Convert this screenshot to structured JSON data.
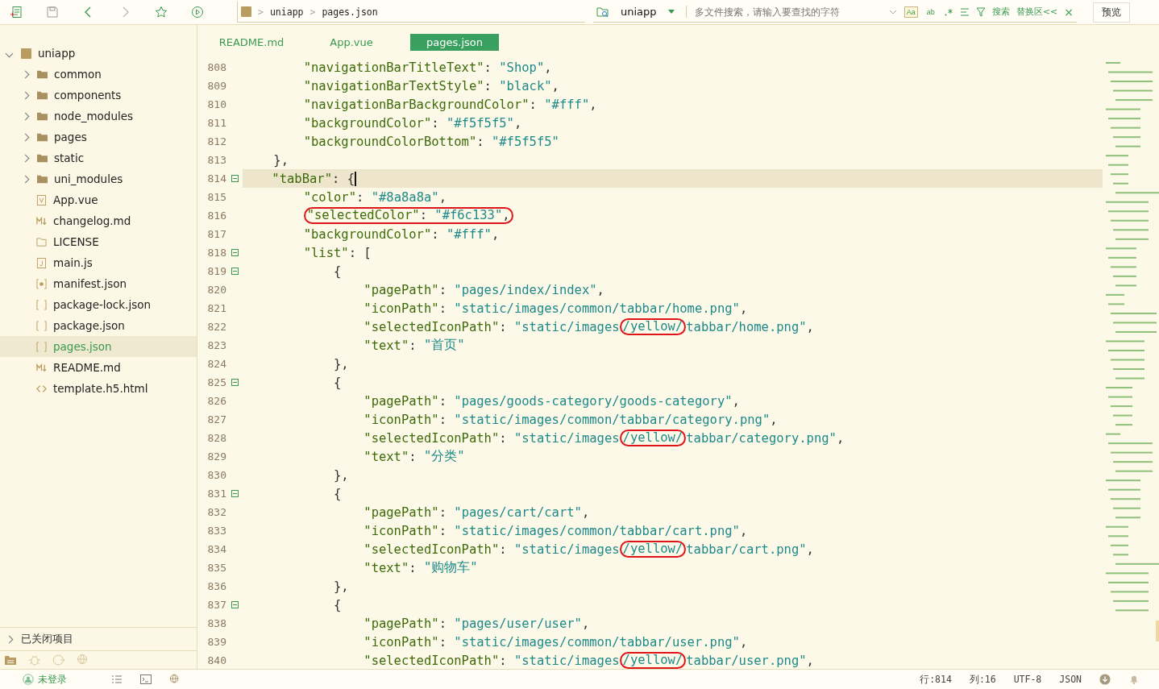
{
  "toolbar": {
    "breadcrumb": [
      "uniapp",
      "pages.json"
    ],
    "breadcrumb_sep": ">"
  },
  "search": {
    "scope": "uniapp",
    "placeholder": "多文件搜索，请输入要查找的字符",
    "options": [
      {
        "label": "Aa",
        "on": true
      },
      {
        "label": "ab",
        "on": false
      }
    ],
    "search_label": "搜索",
    "replace_label": "替换区<<",
    "close": "×",
    "preview": "预览"
  },
  "sidebar": {
    "root": {
      "label": "uniapp",
      "expanded": true,
      "children": [
        {
          "label": "common",
          "kind": "folder",
          "expanded": false,
          "selected": false
        },
        {
          "label": "components",
          "kind": "folder",
          "expanded": false,
          "selected": false
        },
        {
          "label": "node_modules",
          "kind": "folder",
          "expanded": false,
          "selected": false
        },
        {
          "label": "pages",
          "kind": "folder",
          "expanded": false,
          "selected": false
        },
        {
          "label": "static",
          "kind": "folder",
          "expanded": false,
          "selected": false
        },
        {
          "label": "uni_modules",
          "kind": "folder",
          "expanded": false,
          "selected": false
        },
        {
          "label": "App.vue",
          "kind": "vue",
          "selected": false
        },
        {
          "label": "changelog.md",
          "kind": "md",
          "selected": false
        },
        {
          "label": "LICENSE",
          "kind": "file",
          "selected": false
        },
        {
          "label": "main.js",
          "kind": "js",
          "selected": false
        },
        {
          "label": "manifest.json",
          "kind": "manifest",
          "selected": false
        },
        {
          "label": "package-lock.json",
          "kind": "json",
          "selected": false
        },
        {
          "label": "package.json",
          "kind": "json",
          "selected": false
        },
        {
          "label": "pages.json",
          "kind": "json",
          "selected": true
        },
        {
          "label": "README.md",
          "kind": "md",
          "selected": false
        },
        {
          "label": "template.h5.html",
          "kind": "html",
          "selected": false
        }
      ]
    },
    "closed_projects": "已关闭项目"
  },
  "tabs": [
    {
      "label": "README.md",
      "selected": false
    },
    {
      "label": "App.vue",
      "selected": false
    },
    {
      "label": "pages.json",
      "selected": true
    }
  ],
  "editor": {
    "lines": [
      {
        "children": [
          {
            "n": "808",
            "fold": false,
            "current": false,
            "parts": [
              {
                "kind": "k",
                "text": "\"navigationBarTitleText\""
              },
              {
                "kind": "p",
                "text": ": "
              },
              {
                "kind": "s",
                "text": "\"Shop\""
              },
              {
                "kind": "p",
                "text": ","
              }
            ]
          },
          {
            "n": "809",
            "fold": false,
            "current": false,
            "parts": [
              {
                "kind": "k",
                "text": "\"navigationBarTextStyle\""
              },
              {
                "kind": "p",
                "text": ": "
              },
              {
                "kind": "s",
                "text": "\"black\""
              },
              {
                "kind": "p",
                "text": ","
              }
            ]
          },
          {
            "n": "810",
            "fold": false,
            "current": false,
            "parts": [
              {
                "kind": "k",
                "text": "\"navigationBarBackgroundColor\""
              },
              {
                "kind": "p",
                "text": ": "
              },
              {
                "kind": "s",
                "text": "\"#fff\""
              },
              {
                "kind": "p",
                "text": ","
              }
            ]
          },
          {
            "n": "811",
            "fold": false,
            "current": false,
            "parts": [
              {
                "kind": "k",
                "text": "\"backgroundColor\""
              },
              {
                "kind": "p",
                "text": ": "
              },
              {
                "kind": "s",
                "text": "\"#f5f5f5\""
              },
              {
                "kind": "p",
                "text": ","
              }
            ]
          },
          {
            "n": "812",
            "fold": false,
            "current": false,
            "parts": [
              {
                "kind": "k",
                "text": "\"backgroundColorBottom\""
              },
              {
                "kind": "p",
                "text": ": "
              },
              {
                "kind": "s",
                "text": "\"#f5f5f5\""
              }
            ]
          }
        ]
      },
      {
        "n": "813",
        "fold": false,
        "current": false,
        "parts": [
          {
            "kind": "p",
            "text": "},"
          }
        ]
      },
      {
        "n": "814",
        "fold": true,
        "current": true,
        "parts": [
          {
            "kind": "k",
            "text": "\"tabBar\""
          },
          {
            "kind": "p",
            "text": ": {"
          }
        ],
        "children": [
          {
            "n": "815",
            "fold": false,
            "current": false,
            "parts": [
              {
                "kind": "k",
                "text": "\"color\""
              },
              {
                "kind": "p",
                "text": ": "
              },
              {
                "kind": "s",
                "text": "\"#8a8a8a\""
              },
              {
                "kind": "p",
                "text": ","
              }
            ]
          },
          {
            "n": "816",
            "fold": false,
            "current": false,
            "parts": [
              {
                "kind": "circle",
                "parts": [
                  {
                    "kind": "k",
                    "text": "\"selectedColor\""
                  },
                  {
                    "kind": "p",
                    "text": ": "
                  },
                  {
                    "kind": "s",
                    "text": "\"#f6c133\""
                  },
                  {
                    "kind": "p",
                    "text": ","
                  }
                ]
              }
            ]
          },
          {
            "n": "817",
            "fold": false,
            "current": false,
            "parts": [
              {
                "kind": "k",
                "text": "\"backgroundColor\""
              },
              {
                "kind": "p",
                "text": ": "
              },
              {
                "kind": "s",
                "text": "\"#fff\""
              },
              {
                "kind": "p",
                "text": ","
              }
            ]
          },
          {
            "n": "818",
            "fold": true,
            "current": false,
            "parts": [
              {
                "kind": "k",
                "text": "\"list\""
              },
              {
                "kind": "p",
                "text": ": ["
              }
            ],
            "children": [
              {
                "n": "819",
                "fold": true,
                "current": false,
                "parts": [
                  {
                    "kind": "p",
                    "text": "{"
                  }
                ],
                "children": [
                  {
                    "n": "820",
                    "fold": false,
                    "current": false,
                    "parts": [
                      {
                        "kind": "k",
                        "text": "\"pagePath\""
                      },
                      {
                        "kind": "p",
                        "text": ": "
                      },
                      {
                        "kind": "s",
                        "text": "\"pages/index/index\""
                      },
                      {
                        "kind": "p",
                        "text": ","
                      }
                    ]
                  },
                  {
                    "n": "821",
                    "fold": false,
                    "current": false,
                    "parts": [
                      {
                        "kind": "k",
                        "text": "\"iconPath\""
                      },
                      {
                        "kind": "p",
                        "text": ": "
                      },
                      {
                        "kind": "s",
                        "text": "\"static/images/common/tabbar/home.png\""
                      },
                      {
                        "kind": "p",
                        "text": ","
                      }
                    ]
                  },
                  {
                    "n": "822",
                    "fold": false,
                    "current": false,
                    "parts": [
                      {
                        "kind": "k",
                        "text": "\"selectedIconPath\""
                      },
                      {
                        "kind": "p",
                        "text": ": "
                      },
                      {
                        "kind": "s",
                        "text": "\"static/images"
                      },
                      {
                        "kind": "circle",
                        "parts": [
                          {
                            "kind": "s",
                            "text": "/yellow/"
                          }
                        ]
                      },
                      {
                        "kind": "s",
                        "text": "tabbar/home.png\""
                      },
                      {
                        "kind": "p",
                        "text": ","
                      }
                    ]
                  },
                  {
                    "n": "823",
                    "fold": false,
                    "current": false,
                    "parts": [
                      {
                        "kind": "k",
                        "text": "\"text\""
                      },
                      {
                        "kind": "p",
                        "text": ": "
                      },
                      {
                        "kind": "s",
                        "text": "\"首页\""
                      }
                    ]
                  }
                ]
              },
              {
                "n": "824",
                "fold": false,
                "current": false,
                "parts": [
                  {
                    "kind": "p",
                    "text": "},"
                  }
                ]
              },
              {
                "n": "825",
                "fold": true,
                "current": false,
                "parts": [
                  {
                    "kind": "p",
                    "text": "{"
                  }
                ],
                "children": [
                  {
                    "n": "826",
                    "fold": false,
                    "current": false,
                    "parts": [
                      {
                        "kind": "k",
                        "text": "\"pagePath\""
                      },
                      {
                        "kind": "p",
                        "text": ": "
                      },
                      {
                        "kind": "s",
                        "text": "\"pages/goods-category/goods-category\""
                      },
                      {
                        "kind": "p",
                        "text": ","
                      }
                    ]
                  },
                  {
                    "n": "827",
                    "fold": false,
                    "current": false,
                    "parts": [
                      {
                        "kind": "k",
                        "text": "\"iconPath\""
                      },
                      {
                        "kind": "p",
                        "text": ": "
                      },
                      {
                        "kind": "s",
                        "text": "\"static/images/common/tabbar/category.png\""
                      },
                      {
                        "kind": "p",
                        "text": ","
                      }
                    ]
                  },
                  {
                    "n": "828",
                    "fold": false,
                    "current": false,
                    "parts": [
                      {
                        "kind": "k",
                        "text": "\"selectedIconPath\""
                      },
                      {
                        "kind": "p",
                        "text": ": "
                      },
                      {
                        "kind": "s",
                        "text": "\"static/images"
                      },
                      {
                        "kind": "circle",
                        "parts": [
                          {
                            "kind": "s",
                            "text": "/yellow/"
                          }
                        ]
                      },
                      {
                        "kind": "s",
                        "text": "tabbar/category.png\""
                      },
                      {
                        "kind": "p",
                        "text": ","
                      }
                    ]
                  },
                  {
                    "n": "829",
                    "fold": false,
                    "current": false,
                    "parts": [
                      {
                        "kind": "k",
                        "text": "\"text\""
                      },
                      {
                        "kind": "p",
                        "text": ": "
                      },
                      {
                        "kind": "s",
                        "text": "\"分类\""
                      }
                    ]
                  }
                ]
              },
              {
                "n": "830",
                "fold": false,
                "current": false,
                "parts": [
                  {
                    "kind": "p",
                    "text": "},"
                  }
                ]
              },
              {
                "n": "831",
                "fold": true,
                "current": false,
                "parts": [
                  {
                    "kind": "p",
                    "text": "{"
                  }
                ],
                "children": [
                  {
                    "n": "832",
                    "fold": false,
                    "current": false,
                    "parts": [
                      {
                        "kind": "k",
                        "text": "\"pagePath\""
                      },
                      {
                        "kind": "p",
                        "text": ": "
                      },
                      {
                        "kind": "s",
                        "text": "\"pages/cart/cart\""
                      },
                      {
                        "kind": "p",
                        "text": ","
                      }
                    ]
                  },
                  {
                    "n": "833",
                    "fold": false,
                    "current": false,
                    "parts": [
                      {
                        "kind": "k",
                        "text": "\"iconPath\""
                      },
                      {
                        "kind": "p",
                        "text": ": "
                      },
                      {
                        "kind": "s",
                        "text": "\"static/images/common/tabbar/cart.png\""
                      },
                      {
                        "kind": "p",
                        "text": ","
                      }
                    ]
                  },
                  {
                    "n": "834",
                    "fold": false,
                    "current": false,
                    "parts": [
                      {
                        "kind": "k",
                        "text": "\"selectedIconPath\""
                      },
                      {
                        "kind": "p",
                        "text": ": "
                      },
                      {
                        "kind": "s",
                        "text": "\"static/images"
                      },
                      {
                        "kind": "circle",
                        "parts": [
                          {
                            "kind": "s",
                            "text": "/yellow/"
                          }
                        ]
                      },
                      {
                        "kind": "s",
                        "text": "tabbar/cart.png\""
                      },
                      {
                        "kind": "p",
                        "text": ","
                      }
                    ]
                  },
                  {
                    "n": "835",
                    "fold": false,
                    "current": false,
                    "parts": [
                      {
                        "kind": "k",
                        "text": "\"text\""
                      },
                      {
                        "kind": "p",
                        "text": ": "
                      },
                      {
                        "kind": "s",
                        "text": "\"购物车\""
                      }
                    ]
                  }
                ]
              },
              {
                "n": "836",
                "fold": false,
                "current": false,
                "parts": [
                  {
                    "kind": "p",
                    "text": "},"
                  }
                ]
              },
              {
                "n": "837",
                "fold": true,
                "current": false,
                "parts": [
                  {
                    "kind": "p",
                    "text": "{"
                  }
                ],
                "children": [
                  {
                    "n": "838",
                    "fold": false,
                    "current": false,
                    "parts": [
                      {
                        "kind": "k",
                        "text": "\"pagePath\""
                      },
                      {
                        "kind": "p",
                        "text": ": "
                      },
                      {
                        "kind": "s",
                        "text": "\"pages/user/user\""
                      },
                      {
                        "kind": "p",
                        "text": ","
                      }
                    ]
                  },
                  {
                    "n": "839",
                    "fold": false,
                    "current": false,
                    "parts": [
                      {
                        "kind": "k",
                        "text": "\"iconPath\""
                      },
                      {
                        "kind": "p",
                        "text": ": "
                      },
                      {
                        "kind": "s",
                        "text": "\"static/images/common/tabbar/user.png\""
                      },
                      {
                        "kind": "p",
                        "text": ","
                      }
                    ]
                  },
                  {
                    "n": "840",
                    "fold": false,
                    "current": false,
                    "parts": [
                      {
                        "kind": "k",
                        "text": "\"selectedIconPath\""
                      },
                      {
                        "kind": "p",
                        "text": ": "
                      },
                      {
                        "kind": "s",
                        "text": "\"static/images"
                      },
                      {
                        "kind": "circle",
                        "parts": [
                          {
                            "kind": "s",
                            "text": "/yellow/"
                          }
                        ]
                      },
                      {
                        "kind": "s",
                        "text": "tabbar/user.png\""
                      },
                      {
                        "kind": "p",
                        "text": ","
                      }
                    ]
                  }
                ]
              }
            ]
          }
        ]
      }
    ]
  },
  "status_bar": {
    "login": "未登录",
    "line": "行:814",
    "column": "列:16",
    "encoding": "UTF-8",
    "language": "JSON"
  }
}
